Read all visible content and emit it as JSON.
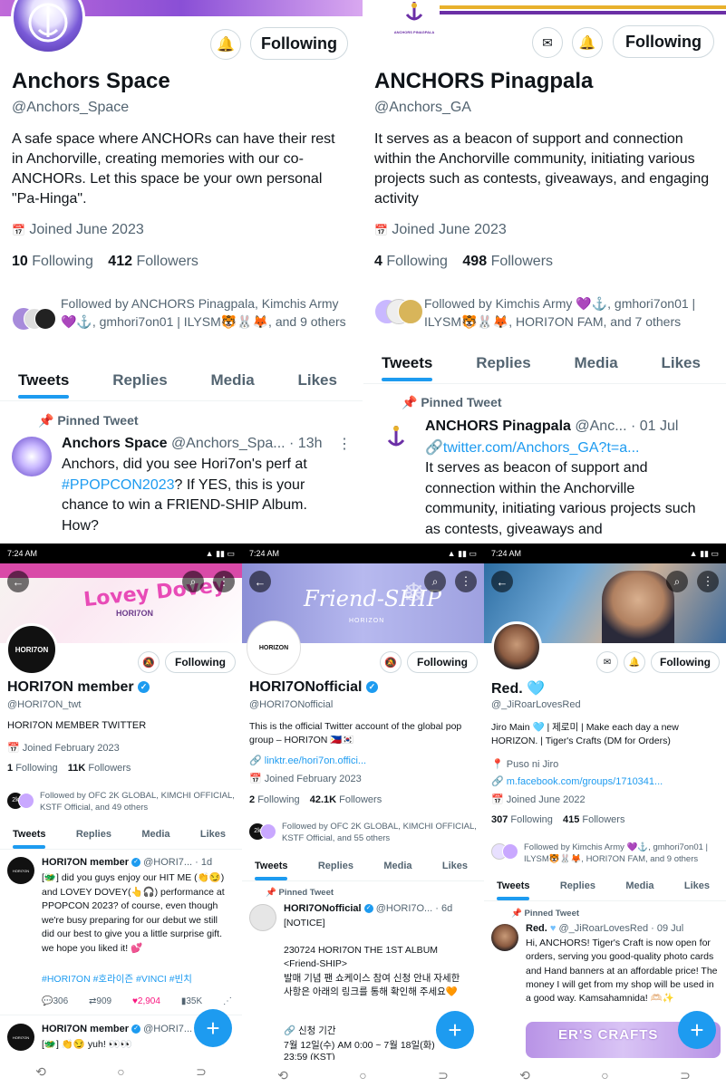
{
  "p1": {
    "name": "Anchors Space",
    "handle": "@Anchors_Space",
    "bio": "A safe space where ANCHORs can have their rest in Anchorville, creating memories with our co-ANCHORs. Let this space be your own personal \"Pa-Hinga\".",
    "joined": "Joined June 2023",
    "following_count": "10",
    "following_label": "Following",
    "followers_count": "412",
    "followers_label": "Followers",
    "followed_by": "Followed by ANCHORS Pinagpala, Kimchis Army 💜⚓, gmhori7on01 | ILYSM🐯🐰🦊, and 9 others",
    "follow_btn": "Following",
    "tabs": [
      "Tweets",
      "Replies",
      "Media",
      "Likes"
    ],
    "pinned": "Pinned Tweet",
    "tweet_name": "Anchors Space",
    "tweet_handle": "@Anchors_Spa...",
    "tweet_time": "· 13h",
    "tweet_text_a": "Anchors, did you see Hori7on's perf at ",
    "tweet_hashtag": "#PPOPCON2023",
    "tweet_text_b": "? If YES, this is your chance to win a FRIEND-SHIP Album. How?"
  },
  "p2": {
    "name": "ANCHORS Pinagpala",
    "handle": "@Anchors_GA",
    "bio": "It serves as a beacon of support and connection within the Anchorville community, initiating various projects such as contests, giveaways, and engaging activity",
    "joined": "Joined June 2023",
    "following_count": "4",
    "following_label": "Following",
    "followers_count": "498",
    "followers_label": "Followers",
    "followed_by": "Followed by Kimchis Army 💜⚓, gmhori7on01 | ILYSM🐯🐰🦊, HORI7ON FAM, and 7 others",
    "follow_btn": "Following",
    "banner_text": "ANCHORS PINAGPALA",
    "tabs": [
      "Tweets",
      "Replies",
      "Media",
      "Likes"
    ],
    "pinned": "Pinned Tweet",
    "tweet_name": "ANCHORS Pinagpala",
    "tweet_handle": "@Anc...",
    "tweet_time": "· 01 Jul",
    "tweet_link": "🔗twitter.com/Anchors_GA?t=a...",
    "tweet_text": "It serves as beacon of support and connection within the Anchorville community, initiating various projects such as contests, giveaways and"
  },
  "p3": {
    "time": "7:24 AM",
    "banner_text": "Lovey Dovey",
    "banner_sub": "HORI7ON",
    "avatar_text": "HORI7ON",
    "name": "HORI7ON member",
    "handle": "@HORI7ON_twt",
    "bio": "HORI7ON MEMBER TWITTER",
    "joined": "Joined February 2023",
    "following_count": "1",
    "following_label": "Following",
    "followers_count": "11K",
    "followers_label": "Followers",
    "followed_by": "Followed by OFC 2K GLOBAL, KIMCHI OFFICIAL, KSTF Official, and 49 others",
    "follow_btn": "Following",
    "tabs": [
      "Tweets",
      "Replies",
      "Media",
      "Likes"
    ],
    "tweet_name": "HORI7ON member",
    "tweet_handle": "@HORI7...",
    "tweet_time": "· 1d",
    "tweet_text": "[🐲] did you guys enjoy our HIT ME (👏😏) and LOVEY DOVEY(👆🎧) performance at PPOPCON 2023? of course, even though we're busy preparing for our debut we still did our best to give you a little surprise gift. we hope you liked it! 💕",
    "tweet_tags": "#HORI7ON #호라이즌 #VINCI #빈치",
    "stat_replies": "306",
    "stat_rt": "909",
    "stat_likes": "2,904",
    "stat_views": "35K",
    "tweet2_name": "HORI7ON member",
    "tweet2_handle": "@HORI7...",
    "tweet2_text": "[🐲] 👏😏 yuh! 👀👀"
  },
  "p4": {
    "time": "7:24 AM",
    "banner_text": "Friend-SHIP",
    "banner_sub": "HORIZON",
    "avatar_text": "HORIZON",
    "name": "HORI7ONofficial",
    "handle": "@HORI7ONofficial",
    "bio": "This is the official Twitter account of the global pop group – HORI7ON 🇵🇭🇰🇷",
    "link": "linktr.ee/hori7on.offici...",
    "joined": "Joined February 2023",
    "following_count": "2",
    "following_label": "Following",
    "followers_count": "42.1K",
    "followers_label": "Followers",
    "followed_by": "Followed by OFC 2K GLOBAL, KIMCHI OFFICIAL, KSTF Official, and 55 others",
    "follow_btn": "Following",
    "tabs": [
      "Tweets",
      "Replies",
      "Media",
      "Likes"
    ],
    "pinned": "Pinned Tweet",
    "tweet_name": "HORI7ONofficial",
    "tweet_handle": "@HORI7O...",
    "tweet_time": "· 6d",
    "tweet_l1": "[NOTICE]",
    "tweet_l2": "230724 HORI7ON THE 1ST ALBUM <Friend-SHIP>",
    "tweet_l3": "발매 기념 팬 쇼케이스 참여 신청 안내 자세한 사항은 아래의 링크를 통해 확인해 주세요🧡",
    "tweet_l4": "🔗 신청 기간",
    "tweet_l5": "7월 12일(수) AM 0:00 ~ 7월 18일(화)",
    "tweet_l6": "23:59 (KST)"
  },
  "p5": {
    "time": "7:24 AM",
    "name": "Red. 🩵",
    "handle": "@_JiRoarLovesRed",
    "bio": "Jiro Main 🩵 | 제로미 | Make each day a new HORIZON. | Tiger's Crafts (DM for Orders)",
    "location": "Puso ni Jiro",
    "link": "m.facebook.com/groups/1710341...",
    "joined": "Joined June 2022",
    "following_count": "307",
    "following_label": "Following",
    "followers_count": "415",
    "followers_label": "Followers",
    "followed_by": "Followed by Kimchis Army 💜⚓, gmhori7on01 | ILYSM🐯🐰🦊, HORI7ON FAM, and 9 others",
    "follow_btn": "Following",
    "tabs": [
      "Tweets",
      "Replies",
      "Media",
      "Likes"
    ],
    "pinned": "Pinned Tweet",
    "tweet_name": "Red.",
    "tweet_handle": "@_JiRoarLovesRed",
    "tweet_time": "· 09 Jul",
    "tweet_text": "Hi, ANCHORS! Tiger's Craft is now open for orders, serving you good-quality photo cards and Hand banners at an affordable price! The money I will get from my shop will be used in a good way. Kamsahamnida! 🫶🏻✨",
    "crafts_text": "ER'S CRAFTS"
  },
  "colors": {
    "blue": "#1d9bf0",
    "gray": "#536471",
    "purple": "#7b3fb3"
  }
}
